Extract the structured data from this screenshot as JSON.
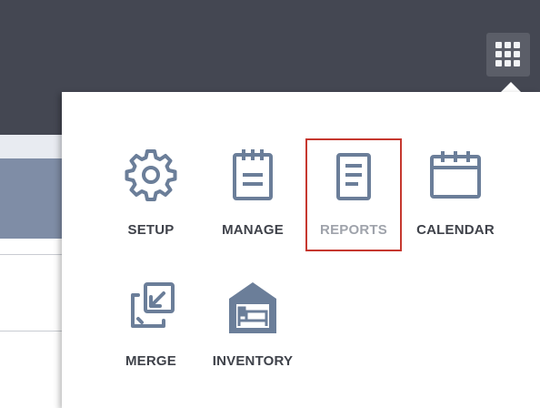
{
  "header": {
    "apps_button_icon": "grid-icon"
  },
  "apps_menu": {
    "items": [
      {
        "label": "SETUP",
        "icon": "gear-icon"
      },
      {
        "label": "MANAGE",
        "icon": "clipboard-icon"
      },
      {
        "label": "REPORTS",
        "icon": "document-icon",
        "selected": true
      },
      {
        "label": "CALENDAR",
        "icon": "calendar-icon"
      },
      {
        "label": "MERGE",
        "icon": "merge-icon"
      },
      {
        "label": "INVENTORY",
        "icon": "house-bed-icon"
      }
    ]
  },
  "colors": {
    "header_bg": "#444752",
    "icon_blue": "#6b7e99",
    "selection_border": "#c6382f"
  }
}
